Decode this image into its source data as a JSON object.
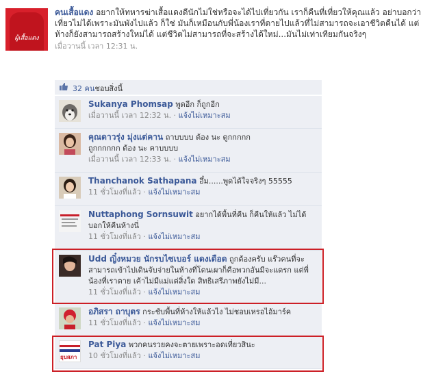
{
  "post": {
    "author": "คนเสื้อแดง",
    "text": "อยากให้ทหารฆ่าเสื้อแดงดีนักไม่ใช่หรือจะได้ไปเที่ยวกัน เราก็คืนที่เที่ยวให้คุณแล้ว อย่าบอกว่าเที่ยวไม่ได้เพราะมันพังไปแล้ว ก็ใช่ มันก็เหมือนกับพี่น้องเราที่ตายไปแล้วที่ไม่สามารถจะเอาชีวิตคืนได้ แต่ห้างก็ยังสามารถสร้างใหม่ได้ แต่ชีวิตไม่สามารถที่จะสร้างได้ใหม่...มันไม่เท่าเทียมกันจริงๆ",
    "time": "เมื่อวานนี้ เวลา 12:31 น."
  },
  "likes": {
    "count_text": "32 คน",
    "suffix": "ชอบสิ่งนี้"
  },
  "report_label": "แจ้งไม่เหมาะสม",
  "comments": [
    {
      "name": "Sukanya Phomsap",
      "text": "พูดอีก ก็ถูกอีก",
      "time": "เมื่อวานนี้ เวลา 12:32 น."
    },
    {
      "name": "คุณดาวรุ่ง มุ่งแต่คาน",
      "text": "ถาบบบบ ต้อง นะ ดูกกกกก",
      "text2": "ถูกกกกกก ต้อง นะ คาบบบบ",
      "time": "เมื่อวานนี้ เวลา 12:33 น."
    },
    {
      "name": "Thanchanok Sathapana",
      "text": "อึ๋ม......พูดได้ใจจริงๆ 55555",
      "time": "11 ชั่วโมงที่แล้ว"
    },
    {
      "name": "Nuttaphong Sornsuwit",
      "text": "อยากได้พื้นที่คืน ก็คืนให้แล้ว ไม่ได้บอกให้คืนห้างนี่",
      "time": "11 ชั่วโมงที่แล้ว"
    },
    {
      "name": "Udd ญิ๋งหมวย นักรบไซเบอร์ แดงเดือด",
      "text": "ถูกต้องครับ แร๊วคนที่จะสามารถเข้าไปเดินจับจ่ายในห้างที่โดนเผาก็คือพวกอันมีจะแดรก แต่พี่น้องที่เราตาย เค้าไม่มีแม่แต่สิ่งใด สิทธิเสรีภาพยังไม่มี...",
      "time": "11 ชั่วโมงที่แล้ว"
    },
    {
      "name": "อภิสรา ถาบุตร",
      "text": "กระชับพื้นที่ห้างให้แล้วไง ไม่ชอบเหรอไอ้มาร์ค",
      "time": "11 ชั่วโมงที่แล้ว"
    },
    {
      "name": "Pat Piya",
      "text": "พวกคนรวยคงจะตายเพราะอดเที่ยวสินะ",
      "time": "10 ชั่วโมงที่แล้ว"
    }
  ],
  "avatar_labels": {
    "post_logo": "ผู้เสื้อแดง",
    "pat_logo": "ยุบสภา"
  },
  "colors": {
    "link": "#3b5998",
    "comment_bg": "#edeff4",
    "highlight": "#cc1f26"
  }
}
